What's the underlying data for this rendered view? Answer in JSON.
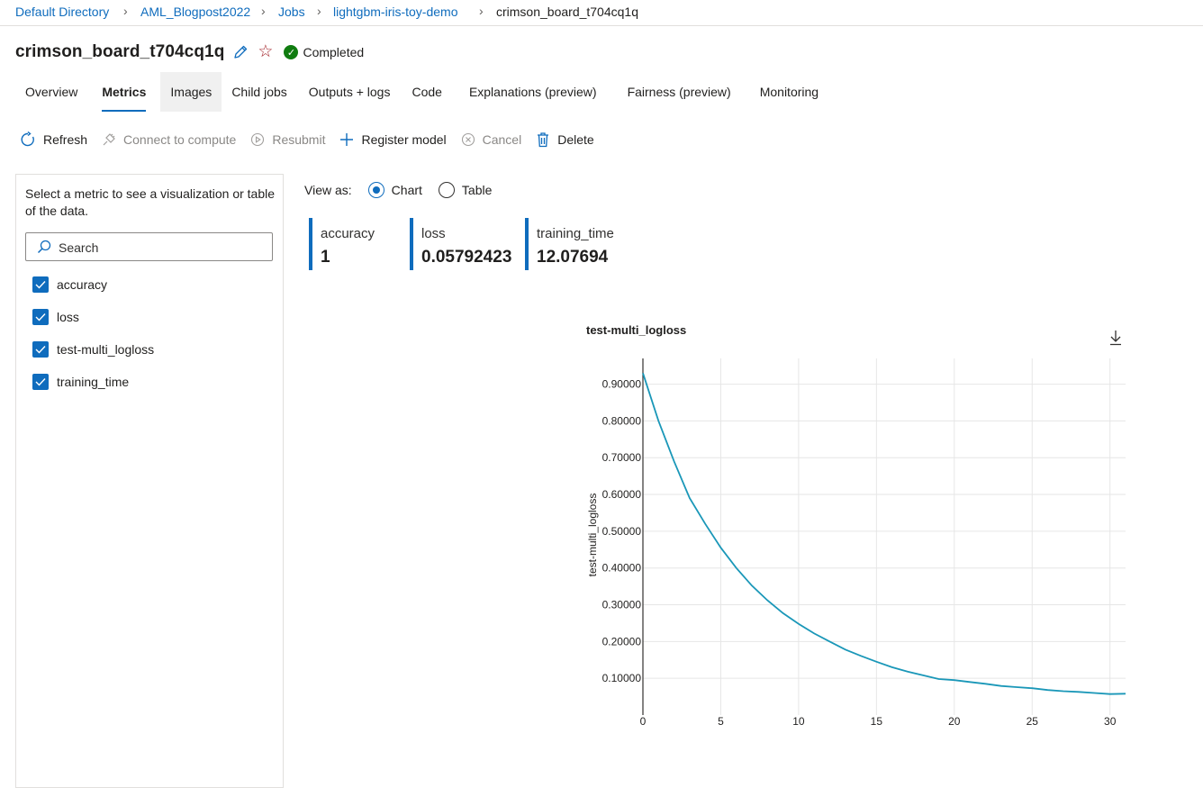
{
  "breadcrumb": {
    "items": [
      "Default Directory",
      "AML_Blogpost2022",
      "Jobs",
      "lightgbm-iris-toy-demo"
    ],
    "current": "crimson_board_t704cq1q"
  },
  "header": {
    "title": "crimson_board_t704cq1q",
    "status": "Completed"
  },
  "tabs": [
    "Overview",
    "Metrics",
    "Images",
    "Child jobs",
    "Outputs + logs",
    "Code",
    "Explanations (preview)",
    "Fairness (preview)",
    "Monitoring"
  ],
  "toolbar": {
    "refresh": "Refresh",
    "connect": "Connect to compute",
    "resubmit": "Resubmit",
    "register": "Register model",
    "cancel": "Cancel",
    "delete": "Delete"
  },
  "left_panel": {
    "description": "Select a metric to see a visualization or table of the data.",
    "search_placeholder": "Search",
    "metrics": [
      "accuracy",
      "loss",
      "test-multi_logloss",
      "training_time"
    ]
  },
  "view_as": {
    "label": "View as:",
    "chart": "Chart",
    "table": "Table",
    "selected": "Chart"
  },
  "metric_cards": [
    {
      "name": "accuracy",
      "value": "1"
    },
    {
      "name": "loss",
      "value": "0.05792423"
    },
    {
      "name": "training_time",
      "value": "12.07694"
    }
  ],
  "colors": {
    "accent": "#0f6cbd",
    "line": "#1a97b8",
    "success": "#107c10"
  },
  "icons": [
    "refresh-icon",
    "plug-icon",
    "play-icon",
    "plus-icon",
    "cancel-icon",
    "trash-icon",
    "search-icon",
    "download-icon",
    "pencil-icon",
    "star-icon",
    "check-icon"
  ],
  "chart_data": {
    "type": "line",
    "title": "test-multi_logloss",
    "xlabel": "",
    "ylabel": "test-multi_logloss",
    "x_ticks": [
      "0",
      "5",
      "10",
      "15",
      "20",
      "25",
      "30"
    ],
    "y_ticks": [
      "0.10000",
      "0.20000",
      "0.30000",
      "0.40000",
      "0.50000",
      "0.60000",
      "0.70000",
      "0.80000",
      "0.90000"
    ],
    "xlim": [
      0,
      31
    ],
    "ylim": [
      0,
      0.97
    ],
    "grid": true,
    "series": [
      {
        "x": [
          0,
          1,
          2,
          3,
          4,
          5,
          6,
          7,
          8,
          9,
          10,
          11,
          12,
          13,
          14,
          15,
          16,
          17,
          18,
          19,
          20,
          21,
          22,
          23,
          24,
          25,
          26,
          27,
          28,
          29,
          30,
          31
        ],
        "values": [
          0.93,
          0.8,
          0.69,
          0.59,
          0.52,
          0.455,
          0.4,
          0.352,
          0.312,
          0.277,
          0.248,
          0.222,
          0.2,
          0.178,
          0.161,
          0.145,
          0.13,
          0.118,
          0.108,
          0.098,
          0.095,
          0.09,
          0.085,
          0.079,
          0.076,
          0.073,
          0.068,
          0.065,
          0.063,
          0.06,
          0.057,
          0.058
        ]
      }
    ]
  }
}
